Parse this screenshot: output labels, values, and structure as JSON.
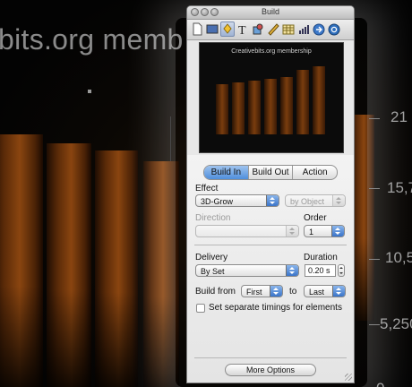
{
  "slide": {
    "title": "bits.org memb",
    "axis_labels": [
      "21",
      "15,7",
      "10,5",
      "5,250",
      "0"
    ]
  },
  "window": {
    "title": "Build",
    "toolbar_icons": [
      "document-icon",
      "slide-icon",
      "build-icon",
      "text-icon",
      "graphic-icon",
      "metrics-icon",
      "table-icon",
      "chart-icon",
      "hyperlink-icon",
      "quicktime-icon"
    ],
    "active_tool": "build-icon"
  },
  "preview": {
    "title": "Creativebits.org membership"
  },
  "build": {
    "tabs": [
      {
        "label": "Build In",
        "selected": true
      },
      {
        "label": "Build Out",
        "selected": false
      },
      {
        "label": "Action",
        "selected": false
      }
    ],
    "effect_label": "Effect",
    "effect_value": "3D-Grow",
    "by_value": "by Object",
    "direction_label": "Direction",
    "direction_value": "",
    "order_label": "Order",
    "order_value": "1",
    "delivery_label": "Delivery",
    "delivery_value": "By Set",
    "duration_label": "Duration",
    "duration_value": "0.20 s",
    "build_from_label": "Build from",
    "build_from_value": "First",
    "to_label": "to",
    "to_value": "Last",
    "separate_timings_label": "Set separate timings for elements",
    "separate_timings_checked": false,
    "more_options_label": "More Options"
  },
  "colors": {
    "selection_blue": "#4f8fdc",
    "window_bg": "#e8e8e8",
    "slide_bg": "#050505"
  }
}
